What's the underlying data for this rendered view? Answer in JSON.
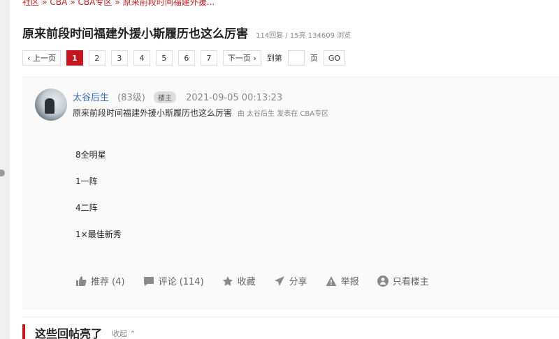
{
  "breadcrumb": [
    "社区",
    "CBA",
    "CBA专区",
    "原来前段时间福建外援..."
  ],
  "post_title": "原来前段时间福建外援小斯履历也这么厉害",
  "post_stats": "114回复 / 15亮 134609 浏览",
  "pager": {
    "prev": "‹ 上一页",
    "pages": [
      "1",
      "2",
      "3",
      "4",
      "5",
      "6",
      "7"
    ],
    "active_page": "1",
    "next": "下一页 ›",
    "goto_prefix": "到第",
    "goto_suffix": "页",
    "go": "GO"
  },
  "post": {
    "username": "太谷后生",
    "level": "(83级)",
    "badge": "楼主",
    "datetime": "2021-09-05 00:13:23",
    "subtitle": "原来前段时间福建外援小斯履历也这么厉害",
    "sub_meta": "由 太谷后生 发表在 CBA专区",
    "content_lines": [
      "8全明星",
      "1一阵",
      "4二阵",
      "1×最佳新秀"
    ]
  },
  "actions": {
    "recommend": "推荐 (4)",
    "comment": "评论 (114)",
    "favorite": "收藏",
    "share": "分享",
    "report": "举报",
    "only_op": "只看楼主"
  },
  "icons": {
    "recommend": "thumbs-up-icon",
    "comment": "comment-icon",
    "favorite": "star-icon",
    "share": "share-icon",
    "report": "warning-icon",
    "only_op": "user-filter-icon"
  },
  "hot_section": {
    "title": "这些回帖亮了",
    "collapse": "收起 ⌃"
  },
  "colors": {
    "accent": "#c4161c",
    "link": "#3b6db5"
  }
}
